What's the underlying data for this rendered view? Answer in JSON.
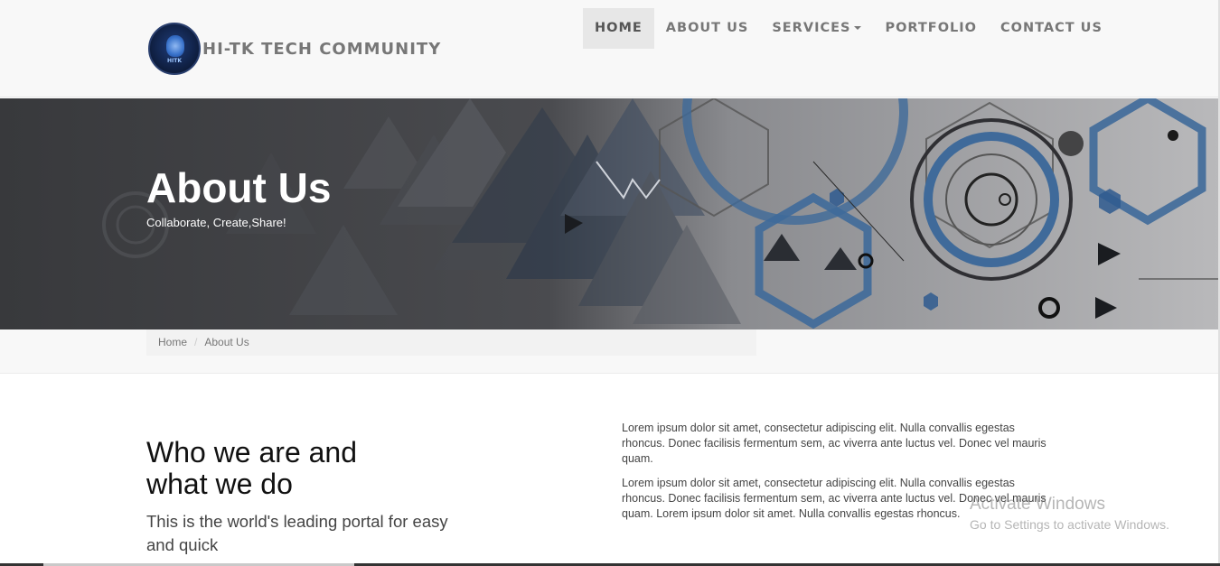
{
  "header": {
    "logo_text": "HITK",
    "brand": "HI-TK TECH COMMUNITY"
  },
  "nav": {
    "items": [
      {
        "label": "HOME",
        "active": true
      },
      {
        "label": "ABOUT US"
      },
      {
        "label": "SERVICES",
        "dropdown": true
      },
      {
        "label": "PORTFOLIO"
      },
      {
        "label": "CONTACT US"
      }
    ]
  },
  "hero": {
    "title": "About Us",
    "subtitle": "Collaborate, Create,Share!"
  },
  "breadcrumb": {
    "home": "Home",
    "separator": "/",
    "current": "About Us"
  },
  "content": {
    "heading": "Who we are and what we do",
    "subheading": "This is the world's leading portal for easy and quick",
    "paragraph1": "Lorem ipsum dolor sit amet, consectetur adipiscing elit. Nulla convallis egestas rhoncus. Donec facilisis fermentum sem, ac viverra ante luctus vel. Donec vel mauris quam.",
    "paragraph2": "Lorem ipsum dolor sit amet, consectetur adipiscing elit. Nulla convallis egestas rhoncus. Donec facilisis fermentum sem, ac viverra ante luctus vel. Donec vel mauris quam. Lorem ipsum dolor sit amet. Nulla convallis egestas rhoncus."
  },
  "watermark": {
    "line1": "Activate Windows",
    "line2": "Go to Settings to activate Windows."
  },
  "colors": {
    "header_bg": "#f8f8f8",
    "nav_text": "#777777",
    "hero_overlay": "#3a3b3e",
    "accent_blue": "#2f5b8f"
  }
}
